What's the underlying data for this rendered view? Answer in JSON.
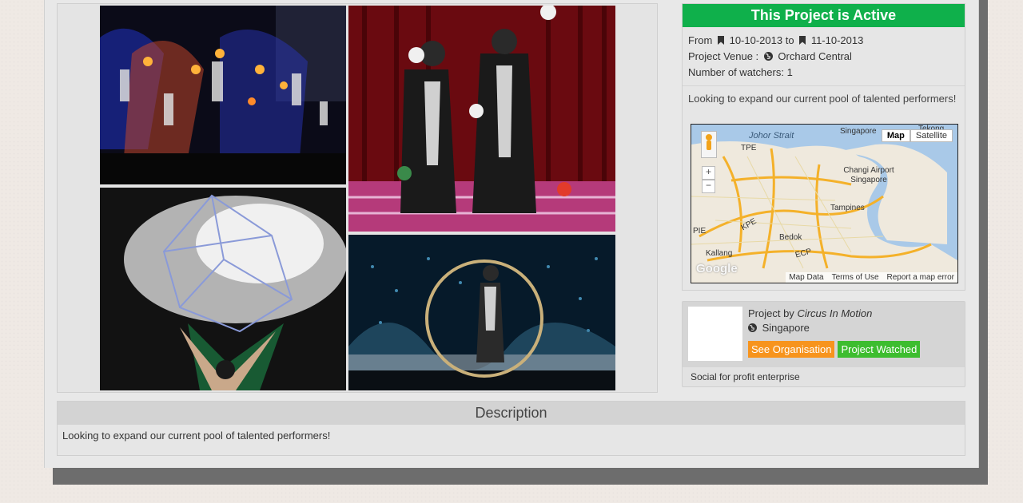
{
  "project": {
    "status_banner": "This Project is Active",
    "from_label": "From",
    "start_date": "10-10-2013",
    "to_label": "to",
    "end_date": "11-10-2013",
    "venue_label": "Project Venue :",
    "venue": "Orchard Central",
    "watchers_label": "Number of watchers:",
    "watchers_count": "1",
    "summary": "Looking to expand our current pool of talented performers!"
  },
  "map": {
    "btn_map": "Map",
    "btn_satellite": "Satellite",
    "labels": [
      "Johor Strait",
      "Singapore",
      "Tekong",
      "TPE",
      "Changi Airport Singapore",
      "Tampines",
      "PIE",
      "KPE",
      "Bedok",
      "Kallang",
      "ECP"
    ],
    "footer": [
      "Map Data",
      "Terms of Use",
      "Report a map error"
    ],
    "logo": "Google",
    "zoom_in": "+",
    "zoom_out": "−"
  },
  "organisation": {
    "by_label": "Project by",
    "name": "Circus In Motion",
    "location": "Singapore",
    "see_button": "See Organisation",
    "watched_button": "Project Watched",
    "type": "Social for profit enterprise"
  },
  "description": {
    "title": "Description",
    "text": "Looking to expand our current pool of talented performers!"
  },
  "icons": {
    "bookmark": "bookmark-icon",
    "globe": "globe-icon"
  },
  "colors": {
    "active": "#0fb04b",
    "see_org": "#f7941d",
    "watched": "#3dbd2f"
  }
}
